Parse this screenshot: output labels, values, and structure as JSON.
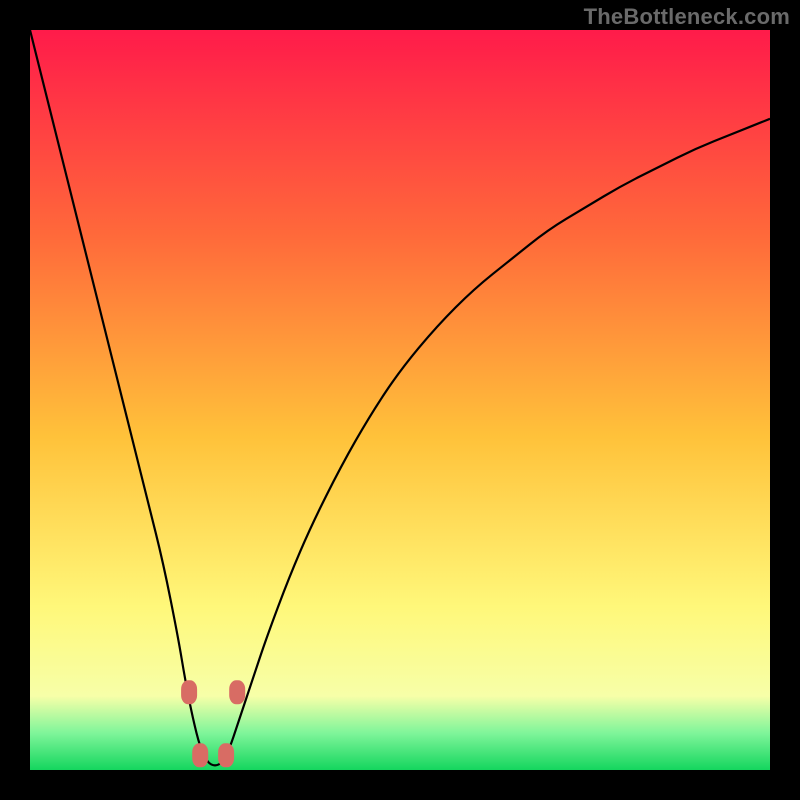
{
  "watermark": "TheBottleneck.com",
  "colors": {
    "black": "#000000",
    "curve": "#000000",
    "marker": "#d86c64",
    "grad_top": "#ff1b4a",
    "grad_mid1": "#ff7c3a",
    "grad_mid2": "#ffd23a",
    "grad_mid3": "#fff87a",
    "grad_green": "#00e660",
    "grad_bottom": "#14d65e"
  },
  "chart_data": {
    "type": "line",
    "title": "",
    "xlabel": "",
    "ylabel": "",
    "xlim": [
      0,
      100
    ],
    "ylim": [
      0,
      100
    ],
    "x": [
      0,
      2,
      4,
      6,
      8,
      10,
      12,
      14,
      16,
      18,
      20,
      21,
      22,
      23,
      24,
      25,
      26,
      27,
      28,
      30,
      32,
      35,
      38,
      42,
      46,
      50,
      55,
      60,
      65,
      70,
      75,
      80,
      85,
      90,
      95,
      100
    ],
    "y": [
      100,
      92,
      84,
      76,
      68,
      60,
      52,
      44,
      36,
      28,
      18,
      12,
      7,
      3,
      1,
      0.5,
      1,
      3,
      6,
      12,
      18,
      26,
      33,
      41,
      48,
      54,
      60,
      65,
      69,
      73,
      76,
      79,
      81.5,
      84,
      86,
      88
    ],
    "markers": {
      "x": [
        21.5,
        23.0,
        26.5,
        28.0
      ],
      "y": [
        10.5,
        2.0,
        2.0,
        10.5
      ]
    },
    "notes": "V-shaped bottleneck mismatch curve; y approximates percentage bottleneck, minimum ~25% along x-axis; background gradient encodes severity (red high, green low)."
  }
}
